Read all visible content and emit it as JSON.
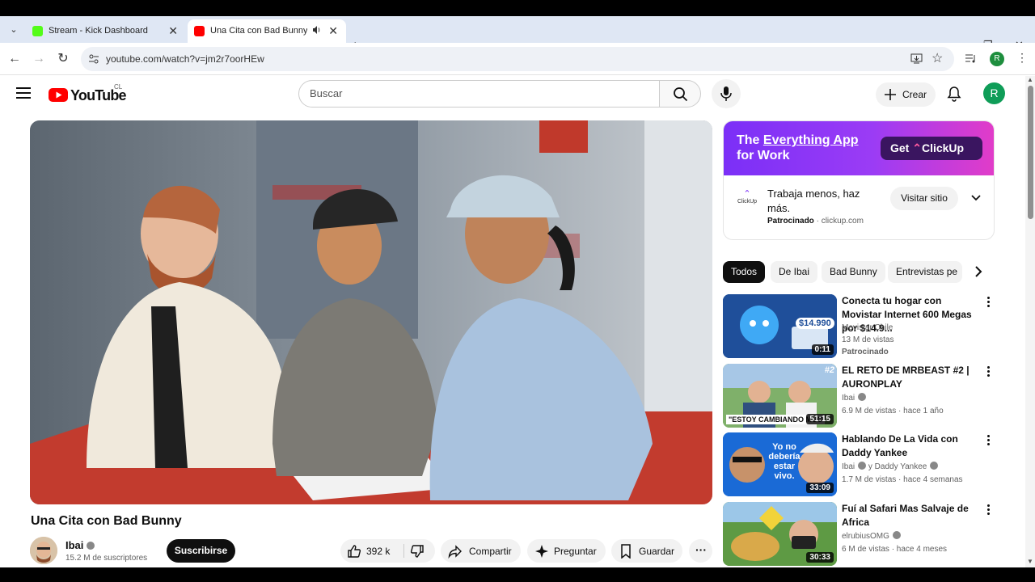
{
  "browser": {
    "tabs": [
      {
        "title": "Stream - Kick Dashboard",
        "favicon_color": "#53fc18"
      },
      {
        "title": "Una Cita con Bad Bunny - YouTube",
        "favicon_color": "#ff0000"
      }
    ],
    "url": "youtube.com/watch?v=jm2r7oorHEw",
    "profile_initial": "R"
  },
  "yt": {
    "logo_text": "YouTube",
    "country": "CL",
    "search_placeholder": "Buscar",
    "create_label": "Crear",
    "avatar_initial": "R"
  },
  "video": {
    "title": "Una Cita con Bad Bunny",
    "channel": "Ibai",
    "subscribers": "15.2 M de suscriptores",
    "subscribe_label": "Suscribirse",
    "likes": "392 k",
    "share_label": "Compartir",
    "ask_label": "Preguntar",
    "save_label": "Guardar"
  },
  "ad": {
    "headline_plain": "The ",
    "headline_link": "Everything App",
    "headline_rest": "for Work",
    "cta_prefix": "Get",
    "cta_brand": "ClickUp",
    "logo_text": "ClickUp",
    "text": "Trabaja menos, haz más.",
    "sponsored": "Patrocinado",
    "domain": "clickup.com",
    "visit_label": "Visitar sitio"
  },
  "chips": [
    "Todos",
    "De Ibai",
    "Bad Bunny",
    "Entrevistas pe"
  ],
  "recommendations": [
    {
      "title": "Conecta tu hogar con Movistar Internet 600 Megas por $14.9...",
      "channel": "Movistar Chile",
      "stats": "13 M de vistas",
      "extra": "Patrocinado",
      "duration": "0:11",
      "price_badge": "$14.990"
    },
    {
      "title": "EL RETO DE MRBEAST #2 | AURONPLAY",
      "channel": "Ibai",
      "stats": "6.9 M de vistas · hace 1 año",
      "duration": "51:15",
      "overlay": "\"ESTOY CAMBIANDO MUC",
      "badge": "#2"
    },
    {
      "title": "Hablando De La Vida con Daddy Yankee",
      "channel": "Ibai",
      "channel_collab": "y Daddy Yankee",
      "stats": "1.7 M de vistas · hace 4 semanas",
      "duration": "33:09",
      "overlay": "Yo no debería estar vivo."
    },
    {
      "title": "Fuí al Safari Mas Salvaje de Africa",
      "channel": "elrubiusOMG",
      "stats": "6 M de vistas · hace 4 meses",
      "duration": "30:33"
    }
  ]
}
